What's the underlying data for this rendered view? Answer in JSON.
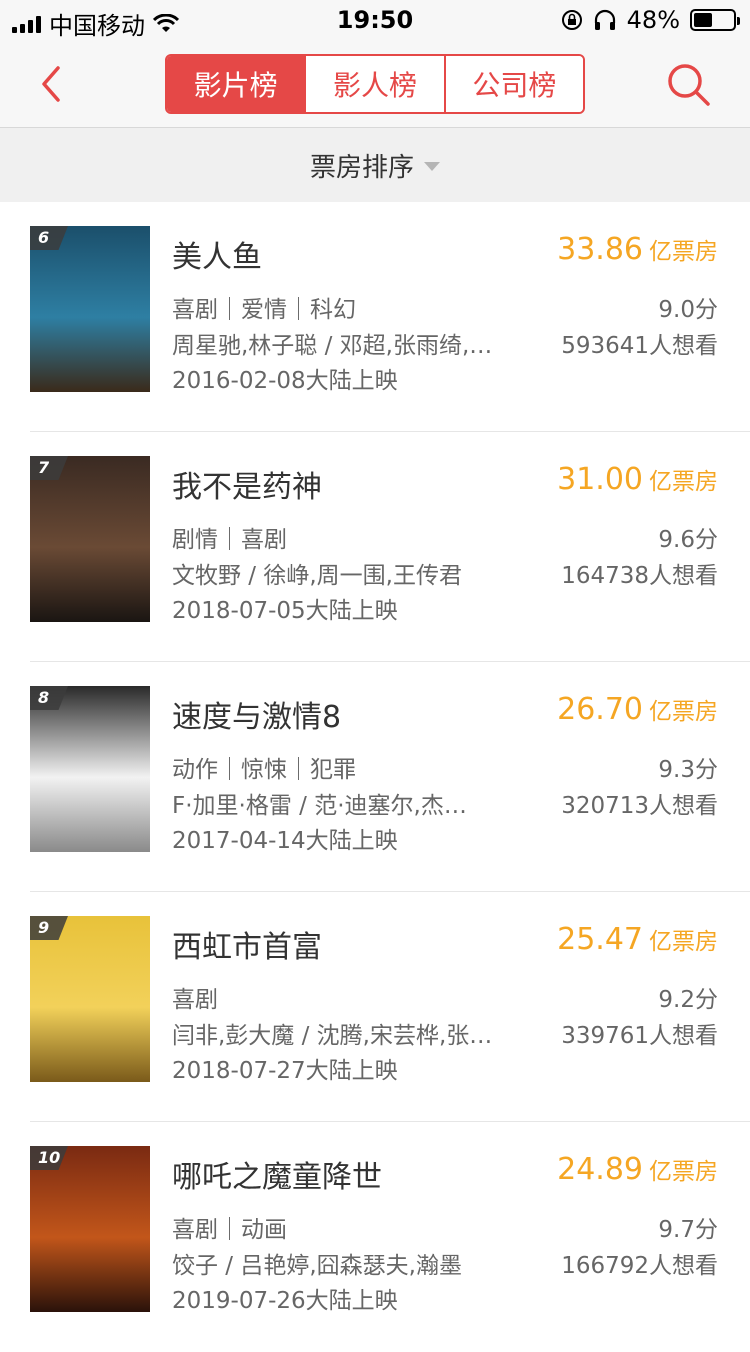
{
  "status_bar": {
    "carrier": "中国移动",
    "time": "19:50",
    "battery_pct": "48%",
    "battery_level": 0.48
  },
  "nav": {
    "tabs": [
      "影片榜",
      "影人榜",
      "公司榜"
    ],
    "active_tab": 0,
    "back_icon": "chevron-left-icon",
    "search_icon": "search-icon",
    "accent": "#e54847"
  },
  "sort": {
    "label": "票房排序"
  },
  "colors": {
    "box_office": "#f5a623"
  },
  "movies": [
    {
      "rank": "6",
      "title": "美人鱼",
      "box_office": "33.86",
      "box_unit": "亿票房",
      "genre": "喜剧｜爱情｜科幻",
      "score": "9.0分",
      "cast": "周星驰,林子聪 / 邓超,张雨绮,…",
      "wish": "593641人想看",
      "release": "2016-02-08大陆上映",
      "poster_colors": [
        "#1b4f6b",
        "#2e7fa3",
        "#3a2a1a"
      ]
    },
    {
      "rank": "7",
      "title": "我不是药神",
      "box_office": "31.00",
      "box_unit": "亿票房",
      "genre": "剧情｜喜剧",
      "score": "9.6分",
      "cast": "文牧野 / 徐峥,周一围,王传君",
      "wish": "164738人想看",
      "release": "2018-07-05大陆上映",
      "poster_colors": [
        "#3a2a22",
        "#6a4a35",
        "#1a1512"
      ]
    },
    {
      "rank": "8",
      "title": "速度与激情8",
      "box_office": "26.70",
      "box_unit": "亿票房",
      "genre": "动作｜惊悚｜犯罪",
      "score": "9.3分",
      "cast": "F·加里·格雷 / 范·迪塞尔,杰…",
      "wish": "320713人想看",
      "release": "2017-04-14大陆上映",
      "poster_colors": [
        "#2a2a2a",
        "#f2f2f2",
        "#8a8a8a"
      ]
    },
    {
      "rank": "9",
      "title": "西虹市首富",
      "box_office": "25.47",
      "box_unit": "亿票房",
      "genre": "喜剧",
      "score": "9.2分",
      "cast": "闫非,彭大魔 / 沈腾,宋芸桦,张…",
      "wish": "339761人想看",
      "release": "2018-07-27大陆上映",
      "poster_colors": [
        "#e8c23a",
        "#f2d15a",
        "#7a5a1a"
      ]
    },
    {
      "rank": "10",
      "title": "哪吒之魔童降世",
      "box_office": "24.89",
      "box_unit": "亿票房",
      "genre": "喜剧｜动画",
      "score": "9.7分",
      "cast": "饺子 / 吕艳婷,囧森瑟夫,瀚墨",
      "wish": "166792人想看",
      "release": "2019-07-26大陆上映",
      "poster_colors": [
        "#7a2a12",
        "#c2561a",
        "#2a120a"
      ]
    }
  ]
}
